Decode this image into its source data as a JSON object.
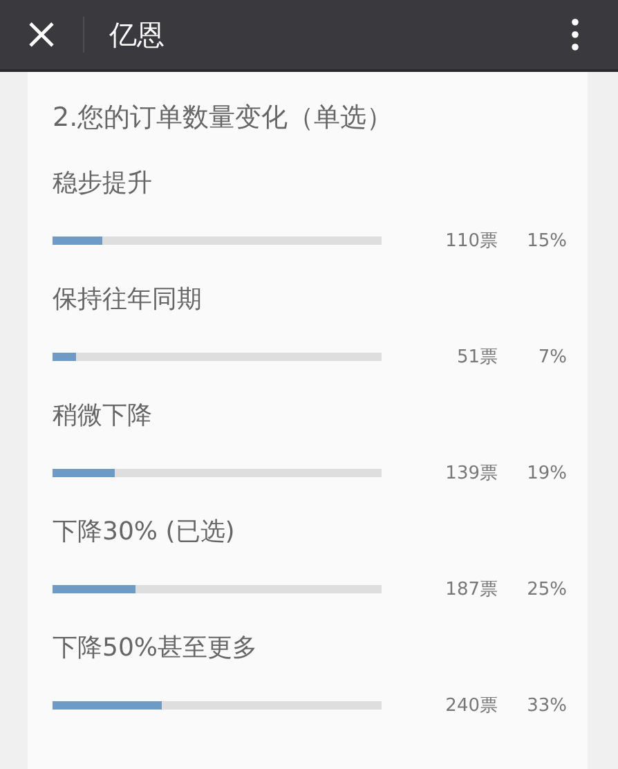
{
  "header": {
    "title": "亿恩"
  },
  "question": {
    "title": "2.您的订单数量变化（单选）"
  },
  "options": [
    {
      "label": "稳步提升",
      "level": 0.15,
      "votes": "110票",
      "percent": "15%"
    },
    {
      "label": "保持往年同期",
      "level": 0.07,
      "votes": "51票",
      "percent": "7%"
    },
    {
      "label": "稍微下降",
      "level": 0.19,
      "votes": "139票",
      "percent": "19%"
    },
    {
      "label": "下降30% (已选)",
      "level": 0.25,
      "votes": "187票",
      "percent": "25%"
    },
    {
      "label": "下降50%甚至更多",
      "level": 0.33,
      "votes": "240票",
      "percent": "33%"
    }
  ]
}
